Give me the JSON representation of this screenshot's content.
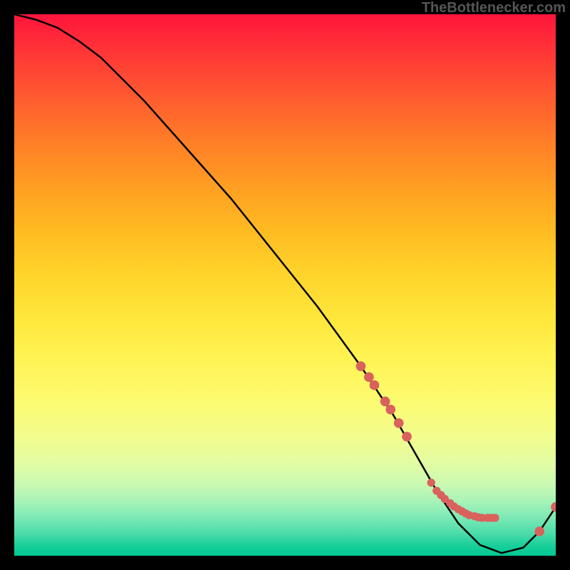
{
  "watermark": "TheBottlenecker.com",
  "chart_data": {
    "type": "line",
    "title": "",
    "xlabel": "",
    "ylabel": "",
    "xlim": [
      0,
      100
    ],
    "ylim": [
      0,
      100
    ],
    "curve": {
      "x": [
        0,
        4,
        8,
        12,
        16,
        24,
        32,
        40,
        48,
        56,
        64,
        70,
        74,
        78,
        82,
        86,
        90,
        94,
        97,
        100
      ],
      "y": [
        100,
        99,
        97.5,
        95,
        92,
        84,
        75,
        66,
        56,
        46,
        35,
        26,
        19,
        12,
        6,
        2,
        0.5,
        1.5,
        4.5,
        9
      ]
    },
    "markers_top": [
      {
        "x": 64.0,
        "y": 35.0
      },
      {
        "x": 65.5,
        "y": 33.0
      },
      {
        "x": 66.5,
        "y": 31.5
      },
      {
        "x": 68.5,
        "y": 28.5
      },
      {
        "x": 69.5,
        "y": 27.0
      },
      {
        "x": 71.0,
        "y": 24.5
      },
      {
        "x": 72.5,
        "y": 22.0
      },
      {
        "x": 97.0,
        "y": 4.5
      },
      {
        "x": 100.0,
        "y": 9.0
      }
    ],
    "markers_bottom": [
      {
        "x": 77.0,
        "y": 13.5
      },
      {
        "x": 78.0,
        "y": 12.0
      },
      {
        "x": 78.8,
        "y": 11.2
      },
      {
        "x": 79.5,
        "y": 10.5
      },
      {
        "x": 80.5,
        "y": 9.7
      },
      {
        "x": 81.2,
        "y": 9.1
      },
      {
        "x": 82.0,
        "y": 8.6
      },
      {
        "x": 82.7,
        "y": 8.2
      },
      {
        "x": 83.4,
        "y": 7.8
      },
      {
        "x": 84.0,
        "y": 7.5
      },
      {
        "x": 85.0,
        "y": 7.3
      },
      {
        "x": 85.7,
        "y": 7.1
      },
      {
        "x": 86.4,
        "y": 7.0
      },
      {
        "x": 87.4,
        "y": 7.0
      },
      {
        "x": 88.1,
        "y": 7.0
      },
      {
        "x": 88.8,
        "y": 7.0
      }
    ],
    "colors": {
      "curve": "#000000",
      "marker": "#d9625d"
    }
  }
}
